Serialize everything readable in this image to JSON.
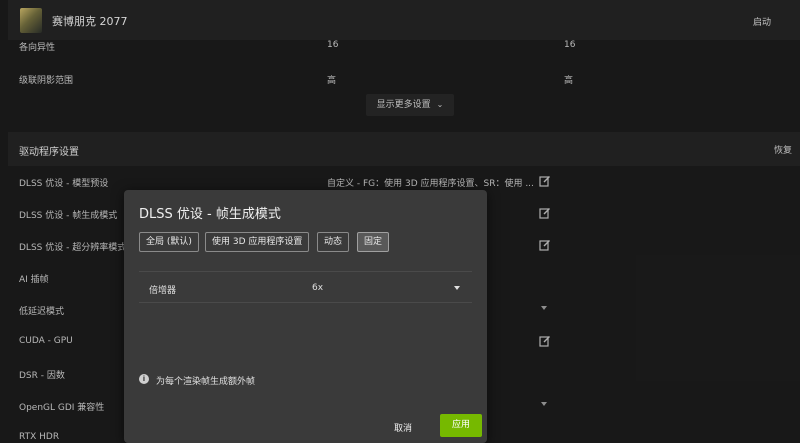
{
  "game": {
    "title": "赛博朋克 2077",
    "launch_label": "启动"
  },
  "graphics_rows": [
    {
      "label": "各向异性",
      "value1": "16",
      "value2": "16"
    },
    {
      "label": "级联阴影范围",
      "value1": "高",
      "value2": "高"
    }
  ],
  "show_more_label": "显示更多设置",
  "driver_section": {
    "title": "驱动程序设置",
    "restore_label": "恢复"
  },
  "driver_rows": [
    {
      "label": "DLSS 优设 - 模型预设",
      "value": "自定义 - FG：使用 3D 应用程序设置、SR：使用 ..."
    },
    {
      "label": "DLSS 优设 - 帧生成模式",
      "value": ""
    },
    {
      "label": "DLSS 优设 - 超分辨率模式",
      "value": ""
    },
    {
      "label": "AI 插帧",
      "value": ""
    },
    {
      "label": "低延迟模式",
      "value": ""
    },
    {
      "label": "CUDA - GPU",
      "value": ""
    },
    {
      "label": "DSR - 因数",
      "value": ""
    },
    {
      "label": "OpenGL GDI 兼容性",
      "value": ""
    },
    {
      "label": "RTX HDR",
      "value": ""
    }
  ],
  "dialog": {
    "title": "DLSS 优设 - 帧生成模式",
    "segments": [
      "全局 (默认)",
      "使用 3D 应用程序设置",
      "动态",
      "固定"
    ],
    "selected_segment": "固定",
    "multiplier_label": "倍增器",
    "multiplier_value": "6x",
    "info_text": "为每个渲染帧生成额外帧",
    "cancel_label": "取消",
    "apply_label": "应用"
  },
  "colors": {
    "accent": "#76b900",
    "background": "#1b1b1b",
    "dialog": "#3a3a3a"
  },
  "icons": {
    "edit": "edit-icon",
    "dropdown": "chevron-down-icon",
    "info": "info-icon"
  }
}
